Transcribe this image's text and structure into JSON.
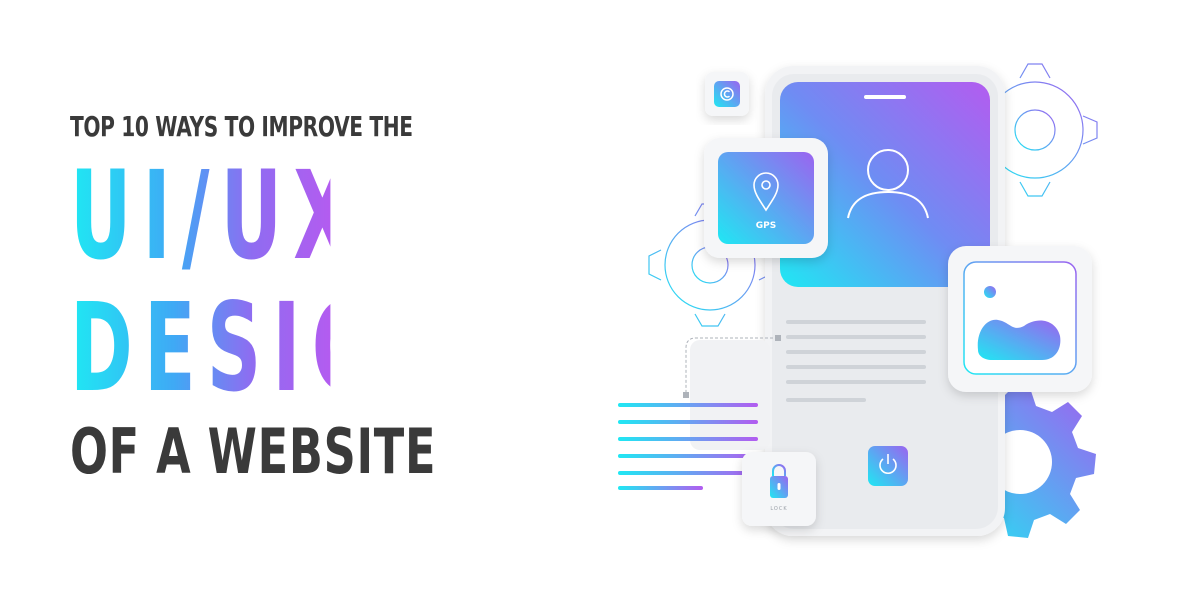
{
  "headline": {
    "top_line": "TOP 10 WAYS TO IMPROVE THE",
    "line_1": "UI/UX",
    "line_2": "DESIGN",
    "line_3": "OF A WEBSITE"
  },
  "illustration": {
    "gps_label": "GPS",
    "lock_label": "LOCK",
    "icons": [
      "copyright-icon",
      "location-pin-icon",
      "user-icon",
      "image-icon",
      "lock-icon",
      "power-icon",
      "gear-icon"
    ]
  },
  "colors": {
    "gradient_start": "#1fe8f3",
    "gradient_mid": "#3fa9f5",
    "gradient_end": "#b35cf0",
    "text_dark": "#3a3a3a"
  }
}
